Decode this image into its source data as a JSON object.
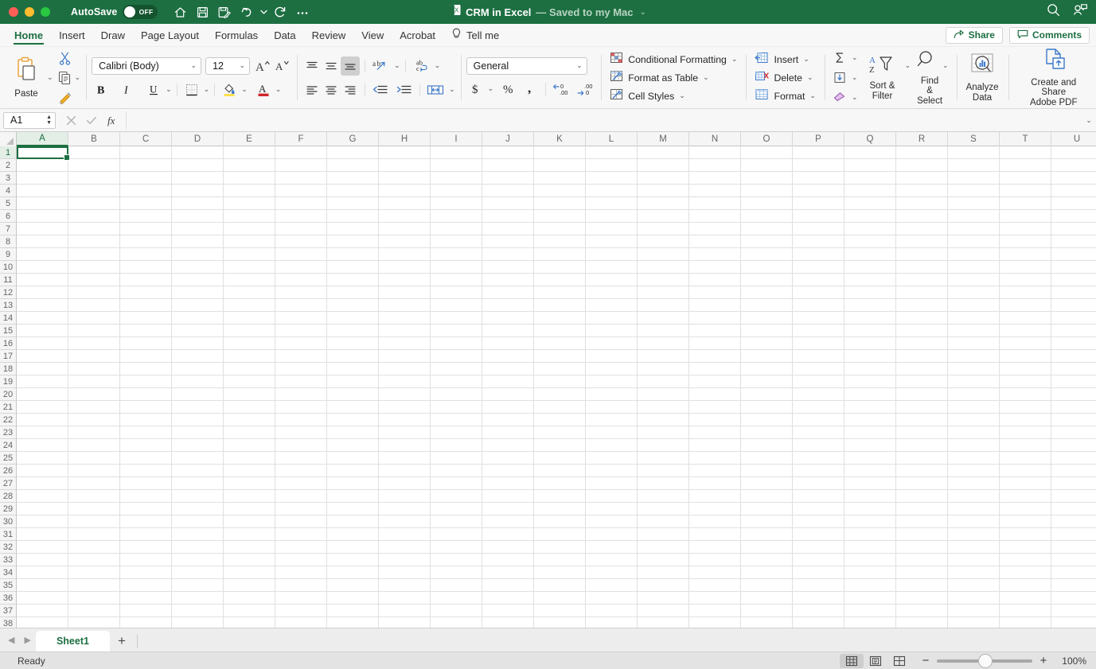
{
  "titlebar": {
    "autosave_label": "AutoSave",
    "autosave_state": "OFF",
    "doc_title": "CRM in Excel",
    "doc_status": "— Saved to my Mac",
    "quick_access": [
      {
        "name": "home-icon",
        "tooltip": "Home"
      },
      {
        "name": "save-icon",
        "tooltip": "Save"
      },
      {
        "name": "save-as-icon",
        "tooltip": "Save As"
      },
      {
        "name": "undo-icon",
        "tooltip": "Undo"
      },
      {
        "name": "redo-icon",
        "tooltip": "Redo"
      },
      {
        "name": "more-icon",
        "tooltip": "More"
      }
    ],
    "right_icons": [
      {
        "name": "search-icon"
      },
      {
        "name": "account-icon"
      }
    ],
    "accent_green": "#1D6F42"
  },
  "tabs": [
    {
      "label": "Home",
      "active": true
    },
    {
      "label": "Insert",
      "active": false
    },
    {
      "label": "Draw",
      "active": false
    },
    {
      "label": "Page Layout",
      "active": false
    },
    {
      "label": "Formulas",
      "active": false
    },
    {
      "label": "Data",
      "active": false
    },
    {
      "label": "Review",
      "active": false
    },
    {
      "label": "View",
      "active": false
    },
    {
      "label": "Acrobat",
      "active": false
    }
  ],
  "tellme": "Tell me",
  "share_label": "Share",
  "comments_label": "Comments",
  "ribbon": {
    "paste_label": "Paste",
    "font_name": "Calibri (Body)",
    "font_size": "12",
    "number_format": "General",
    "styles": [
      {
        "label": "Conditional Formatting"
      },
      {
        "label": "Format as Table"
      },
      {
        "label": "Cell Styles"
      }
    ],
    "cells": [
      {
        "label": "Insert"
      },
      {
        "label": "Delete"
      },
      {
        "label": "Format"
      }
    ],
    "sort_filter_label": "Sort &\nFilter",
    "sort_filter_line1": "Sort &",
    "sort_filter_line2": "Filter",
    "find_select_line1": "Find &",
    "find_select_line2": "Select",
    "analyze_line1": "Analyze",
    "analyze_line2": "Data",
    "adobe_line1": "Create and Share",
    "adobe_line2": "Adobe PDF"
  },
  "formulabar": {
    "name_box": "A1",
    "formula_value": ""
  },
  "grid": {
    "columns": [
      "A",
      "B",
      "C",
      "D",
      "E",
      "F",
      "G",
      "H",
      "I",
      "J",
      "K",
      "L",
      "M",
      "N",
      "O",
      "P",
      "Q",
      "R",
      "S",
      "T",
      "U"
    ],
    "rows": [
      1,
      2,
      3,
      4,
      5,
      6,
      7,
      8,
      9,
      10,
      11,
      12,
      13,
      14,
      15,
      16,
      17,
      18,
      19,
      20,
      21,
      22,
      23,
      24,
      25,
      26,
      27,
      28,
      29,
      30,
      31,
      32,
      33,
      34,
      35,
      36,
      37,
      38
    ],
    "selected_cell": "A1",
    "selected_column": "A",
    "selected_row": 1
  },
  "sheets": {
    "tabs": [
      "Sheet1"
    ],
    "active": "Sheet1",
    "add_label": "+"
  },
  "statusbar": {
    "status": "Ready",
    "zoom": "100%",
    "views": [
      "normal-view",
      "page-layout-view",
      "page-break-view"
    ]
  }
}
